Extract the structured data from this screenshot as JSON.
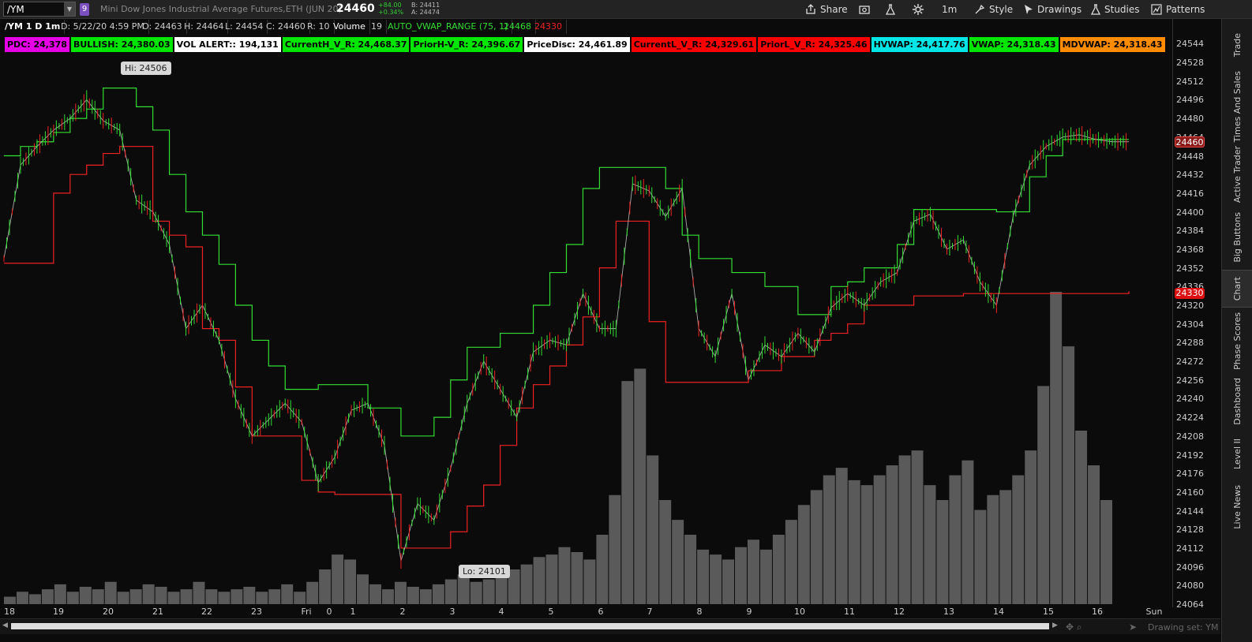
{
  "topbar": {
    "symbol": "/YM",
    "link_badge": "9",
    "description": "Mini Dow Jones Industrial Average Futures,ETH (JUN 20)",
    "last_price": "24460",
    "net_change": "+84.00",
    "pct_change": "+0.34%",
    "bid": "B: 24411",
    "ask": "A: 24474",
    "buttons": {
      "share": "Share",
      "timeframe": "1m",
      "style": "Style",
      "drawings": "Drawings",
      "studies": "Studies",
      "patterns": "Patterns"
    }
  },
  "infobar": {
    "chart_id": "/YM 1 D 1m",
    "date": "D: 5/22/20 4:59 PM",
    "open": "O: 24463",
    "high": "H: 24464",
    "low": "L: 24454",
    "close": "C: 24460",
    "range": "R: 10",
    "volume_label": "Volume",
    "volume_value": "19",
    "study": "AUTO_VWAP_RANGE (75, 1)",
    "study_high": "24468",
    "study_low": "24330"
  },
  "study_labels": [
    {
      "text": "PDC: 24,378",
      "bg": "#e600e6",
      "fg": "#000000"
    },
    {
      "text": "BULLISH: 24,380.03",
      "bg": "#00e600",
      "fg": "#000000"
    },
    {
      "text": "VOL ALERT:: 194,131",
      "bg": "#ffffff",
      "fg": "#000000"
    },
    {
      "text": "CurrentH_V_R:  24,468.37",
      "bg": "#00e600",
      "fg": "#000000"
    },
    {
      "text": "PriorH-V_R:  24,396.67",
      "bg": "#00e600",
      "fg": "#000000"
    },
    {
      "text": "PriceDisc: 24,461.89",
      "bg": "#ffffff",
      "fg": "#000000"
    },
    {
      "text": "CurrentL_V_R:  24,329.61",
      "bg": "#ff0000",
      "fg": "#000000"
    },
    {
      "text": "PriorL_V_R:  24,325.46",
      "bg": "#ff0000",
      "fg": "#000000"
    },
    {
      "text": "HVWAP: 24,417.76",
      "bg": "#00e6e6",
      "fg": "#000000"
    },
    {
      "text": "VWAP: 24,318.43",
      "bg": "#00e600",
      "fg": "#000000"
    },
    {
      "text": "MDVWAP: 24,318.43",
      "bg": "#ff8c00",
      "fg": "#000000"
    }
  ],
  "chart_data": {
    "type": "line",
    "title": "",
    "ylim": [
      24064,
      24549
    ],
    "y_ticks": [
      "24544",
      "24528",
      "24512",
      "24496",
      "24480",
      "24464",
      "24448",
      "24432",
      "24416",
      "24400",
      "24384",
      "24368",
      "24352",
      "24336",
      "24320",
      "24304",
      "24288",
      "24272",
      "24256",
      "24240",
      "24224",
      "24208",
      "24192",
      "24176",
      "24160",
      "24144",
      "24128",
      "24112",
      "24096",
      "24080",
      "24064"
    ],
    "x_ticks": [
      "18",
      "19",
      "20",
      "21",
      "22",
      "23",
      "Fri",
      "0",
      "1",
      "2",
      "3",
      "4",
      "5",
      "6",
      "7",
      "8",
      "9",
      "10",
      "11",
      "12",
      "13",
      "14",
      "15",
      "16",
      "Sun"
    ],
    "price_tags": {
      "last": "24460",
      "lower": "24330"
    },
    "high_marker": "Hi: 24506",
    "low_marker": "Lo: 24101",
    "series": [
      {
        "color": "#33dd33",
        "x": [
          0,
          1,
          2,
          3,
          4,
          5,
          6,
          7,
          8,
          9,
          10,
          11,
          12,
          13,
          14,
          15,
          16,
          17,
          18,
          19,
          20,
          21,
          22,
          23,
          24,
          25,
          26,
          27,
          28,
          29,
          30,
          31,
          32,
          33,
          34,
          35,
          36,
          37,
          38,
          39,
          40,
          41,
          42,
          43,
          44,
          45,
          46,
          47,
          48,
          49,
          50,
          51,
          52,
          53,
          54,
          55,
          56,
          57,
          58,
          59,
          60,
          61,
          62,
          63,
          64,
          65,
          66,
          67,
          68
        ],
        "y": [
          24448,
          24456,
          24460,
          24468,
          24480,
          24488,
          24506,
          24506,
          24490,
          24470,
          24432,
          24400,
          24380,
          24355,
          24320,
          24290,
          24268,
          24248,
          24248,
          24252,
          24252,
          24252,
          24232,
          24232,
          24208,
          24208,
          24224,
          24256,
          24284,
          24284,
          24296,
          24296,
          24320,
          24348,
          24372,
          24420,
          24438,
          24438,
          24438,
          24438,
          24420,
          24380,
          24360,
          24360,
          24348,
          24348,
          24336,
          24336,
          24312,
          24312,
          24336,
          24340,
          24352,
          24352,
          24372,
          24402,
          24402,
          24402,
          24402,
          24402,
          24400,
          24400,
          24430,
          24448,
          24462,
          24462,
          24462,
          24462,
          24462
        ]
      },
      {
        "color": "#ee2222",
        "x": [
          0,
          1,
          2,
          3,
          4,
          5,
          6,
          7,
          8,
          9,
          10,
          11,
          12,
          13,
          14,
          15,
          16,
          17,
          18,
          19,
          20,
          21,
          22,
          23,
          24,
          25,
          26,
          27,
          28,
          29,
          30,
          31,
          32,
          33,
          34,
          35,
          36,
          37,
          38,
          39,
          40,
          41,
          42,
          43,
          44,
          45,
          46,
          47,
          48,
          49,
          50,
          51,
          52,
          53,
          54,
          55,
          56,
          57,
          58,
          59,
          60,
          61,
          62,
          63,
          64,
          65,
          66,
          67,
          68
        ],
        "y": [
          24356,
          24356,
          24356,
          24416,
          24432,
          24440,
          24450,
          24456,
          24456,
          24392,
          24380,
          24370,
          24300,
          24290,
          24250,
          24208,
          24208,
          24208,
          24170,
          24160,
          24158,
          24158,
          24158,
          24158,
          24112,
          24112,
          24112,
          24126,
          24148,
          24166,
          24200,
          24232,
          24252,
          24268,
          24286,
          24310,
          24352,
          24392,
          24392,
          24306,
          24254,
          24254,
          24254,
          24254,
          24254,
          24264,
          24264,
          24276,
          24276,
          24290,
          24296,
          24304,
          24320,
          24320,
          24320,
          24328,
          24328,
          24328,
          24330,
          24330,
          24330,
          24330,
          24330,
          24330,
          24330,
          24330,
          24330,
          24330,
          24332
        ]
      },
      {
        "color": "#dddddd",
        "x": [
          0,
          1,
          2,
          3,
          4,
          5,
          6,
          7,
          8,
          9,
          10,
          11,
          12,
          13,
          14,
          15,
          16,
          17,
          18,
          19,
          20,
          21,
          22,
          23,
          24,
          25,
          26,
          27,
          28,
          29,
          30,
          31,
          32,
          33,
          34,
          35,
          36,
          37,
          38,
          39,
          40,
          41,
          42,
          43,
          44,
          45,
          46,
          47,
          48,
          49,
          50,
          51,
          52,
          53,
          54,
          55,
          56,
          57,
          58,
          59,
          60,
          61,
          62,
          63,
          64,
          65,
          66,
          67,
          68
        ],
        "y": [
          24360,
          24440,
          24456,
          24470,
          24480,
          24496,
          24478,
          24470,
          24410,
          24400,
          24372,
          24300,
          24320,
          24290,
          24240,
          24208,
          24222,
          24236,
          24220,
          24168,
          24190,
          24230,
          24236,
          24200,
          24101,
          24150,
          24136,
          24180,
          24236,
          24272,
          24248,
          24224,
          24280,
          24290,
          24286,
          24330,
          24300,
          24300,
          24424,
          24418,
          24396,
          24420,
          24300,
          24276,
          24330,
          24256,
          24286,
          24276,
          24296,
          24280,
          24318,
          24330,
          24320,
          24340,
          24348,
          24392,
          24398,
          24368,
          24376,
          24340,
          24320,
          24396,
          24440,
          24456,
          24464,
          24466,
          24462,
          24460,
          24460
        ]
      }
    ]
  },
  "volume_data": [
    3,
    5,
    4,
    6,
    8,
    5,
    7,
    6,
    9,
    5,
    6,
    8,
    7,
    5,
    6,
    9,
    6,
    5,
    6,
    7,
    5,
    6,
    8,
    5,
    9,
    14,
    20,
    18,
    12,
    8,
    6,
    9,
    7,
    6,
    8,
    10,
    12,
    9,
    10,
    12,
    14,
    16,
    19,
    20,
    23,
    21,
    18,
    28,
    44,
    90,
    95,
    60,
    42,
    34,
    28,
    22,
    20,
    18,
    23,
    26,
    22,
    28,
    34,
    40,
    46,
    52,
    55,
    50,
    48,
    52,
    56,
    60,
    62,
    48,
    42,
    52,
    58,
    38,
    44,
    46,
    52,
    62,
    88,
    126,
    104,
    70,
    56,
    42
  ],
  "sidebar": [
    "Trade",
    "Times And Sales",
    "Active Trader",
    "Big Buttons",
    "Chart",
    "Phase Scores",
    "Dashboard",
    "Level II",
    "Live News"
  ],
  "footer": {
    "drawing_set": "Drawing set: YM"
  },
  "colors": {
    "up": "#33dd33",
    "down": "#ee2222",
    "volume": "#5a5a5a",
    "panel": "#232323"
  }
}
